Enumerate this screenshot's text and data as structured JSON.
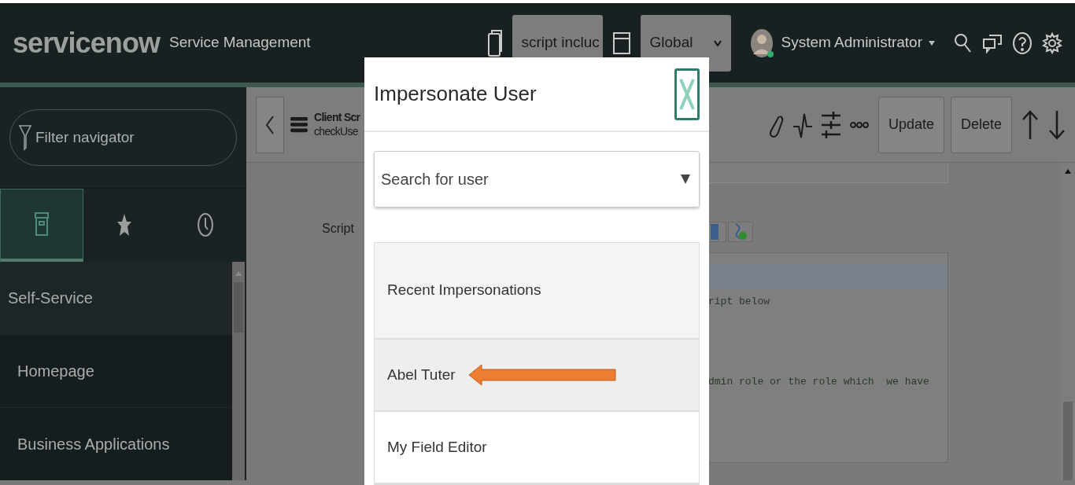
{
  "header": {
    "logo": "servicenow",
    "product": "Service Management",
    "selects": [
      {
        "value": "script incluc",
        "kind": "update-set"
      },
      {
        "value": "Global",
        "kind": "scope"
      }
    ],
    "user": "System Administrator"
  },
  "sidebar": {
    "filter": {
      "placeholder": "Filter navigator"
    },
    "tabs": [
      {
        "kind": "all",
        "selected": true
      },
      {
        "kind": "favorites",
        "selected": false
      },
      {
        "kind": "history",
        "selected": false
      }
    ],
    "items": [
      {
        "label": "Self-Service",
        "kind": "section"
      },
      {
        "label": "Homepage",
        "kind": "module"
      },
      {
        "label": "Business Applications",
        "kind": "module"
      }
    ]
  },
  "form": {
    "title": "Client Scr",
    "subtitle": "checkUse",
    "buttons": [
      "Update",
      "Delete"
    ],
    "script_label": "Script",
    "code_lines": [
      "ript below",
      "dmin role or the role which  we have"
    ]
  },
  "modal": {
    "title": "Impersonate User",
    "search": {
      "placeholder": "Search for user"
    },
    "items": [
      {
        "label": "Recent Impersonations",
        "kind": "heading"
      },
      {
        "label": "Abel Tuter",
        "kind": "user",
        "selected": true,
        "pointed": true
      },
      {
        "label": "My Field Editor",
        "kind": "user",
        "selected": false,
        "pointed": false
      }
    ]
  }
}
